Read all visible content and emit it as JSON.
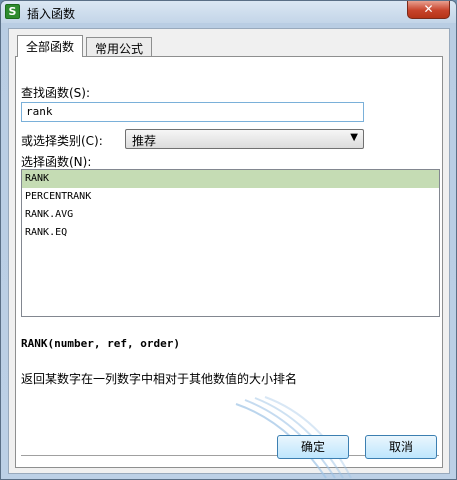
{
  "window": {
    "title": "插入函数",
    "app_icon_glyph": "S",
    "close_glyph": "✕"
  },
  "tabs": [
    {
      "label": "全部函数",
      "active": true
    },
    {
      "label": "常用公式",
      "active": false
    }
  ],
  "search": {
    "label": "查找函数(S):",
    "value": "rank"
  },
  "category": {
    "label": "或选择类别(C):",
    "selected": "推荐"
  },
  "function_list": {
    "label": "选择函数(N):",
    "items": [
      "RANK",
      "PERCENTRANK",
      "RANK.AVG",
      "RANK.EQ"
    ],
    "selected_index": 0
  },
  "details": {
    "signature": "RANK(number, ref, order)",
    "description": "返回某数字在一列数字中相对于其他数值的大小排名"
  },
  "buttons": {
    "ok_label": "确定",
    "cancel_label": "取消"
  },
  "colors": {
    "selection": "#c5dcb4",
    "close_button": "#c7432b",
    "app_icon": "#2e8b2e"
  }
}
